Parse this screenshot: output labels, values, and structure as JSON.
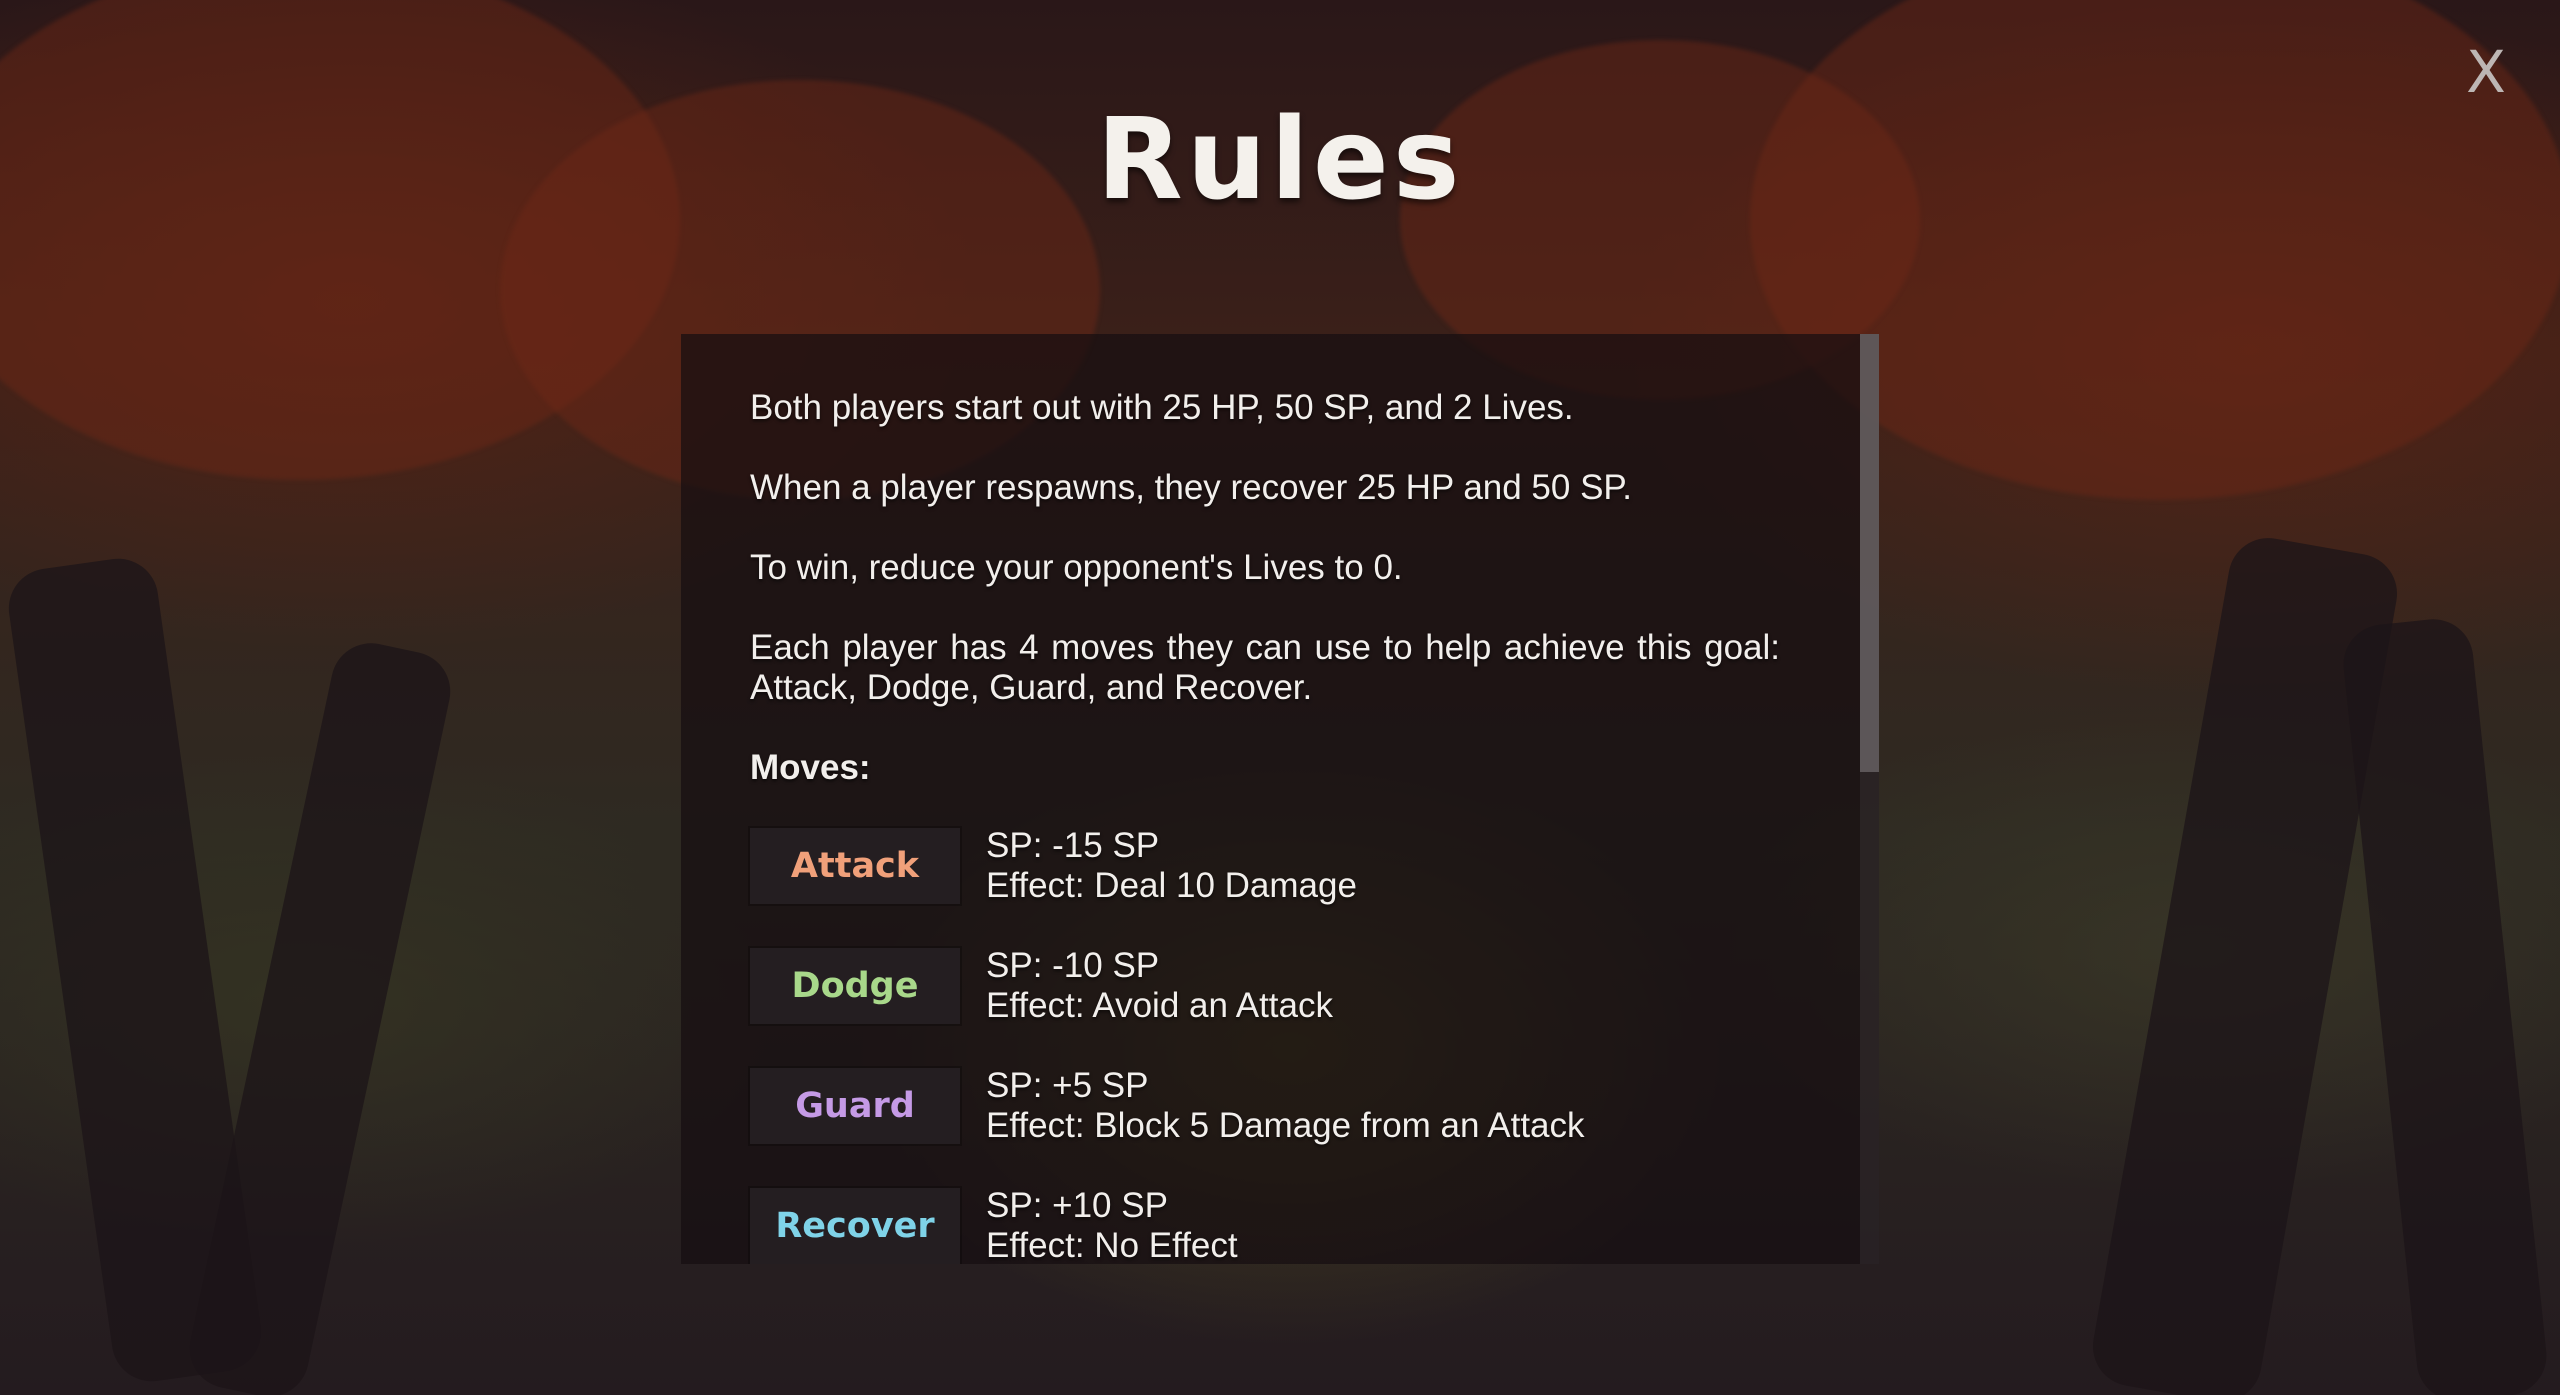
{
  "screen": {
    "title": "Rules",
    "close_label": "X"
  },
  "rules": {
    "paragraphs": [
      "Both players start out with 25 HP, 50 SP, and 2 Lives.",
      "When a player respawns, they recover 25 HP and 50 SP.",
      "To win, reduce your opponent's Lives to 0.",
      "Each player has 4 moves they can use to help achieve this goal: Attack, Dodge, Guard, and Recover."
    ],
    "moves_heading": "Moves:",
    "moves": [
      {
        "name": "Attack",
        "color": "#f0a07a",
        "sp": "SP: -15 SP",
        "effect": "Effect: Deal 10 Damage"
      },
      {
        "name": "Dodge",
        "color": "#a8d88a",
        "sp": "SP: -10 SP",
        "effect": "Effect: Avoid an Attack"
      },
      {
        "name": "Guard",
        "color": "#c59ae6",
        "sp": "SP: +5 SP",
        "effect": "Effect: Block 5 Damage from an Attack"
      },
      {
        "name": "Recover",
        "color": "#7fd3e8",
        "sp": "SP: +10 SP",
        "effect": "Effect: No Effect"
      }
    ]
  },
  "icons": {
    "close": "close-icon"
  }
}
